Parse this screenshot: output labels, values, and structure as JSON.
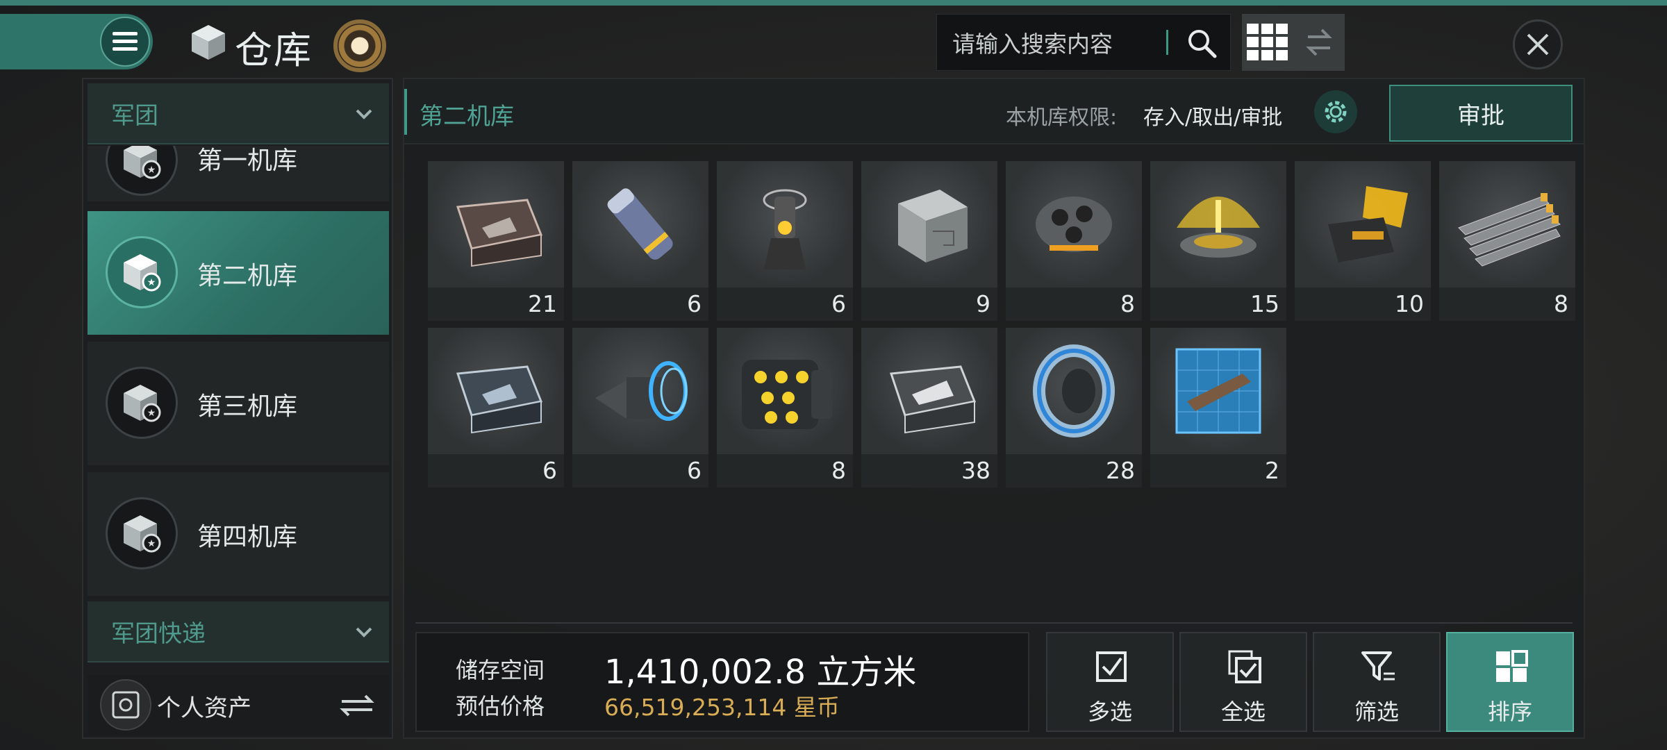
{
  "header": {
    "title": "仓库"
  },
  "search": {
    "placeholder": "请输入搜索内容"
  },
  "left_panel": {
    "group_label": "军团",
    "partial_item_label": "第一机库",
    "hangars": [
      {
        "label": "第二机库",
        "selected": true
      },
      {
        "label": "第三机库",
        "selected": false
      },
      {
        "label": "第四机库",
        "selected": false
      }
    ],
    "express_label": "军团快递",
    "personal_label": "个人资产"
  },
  "hangar": {
    "title": "第二机库",
    "permission_label": "本机库权限:",
    "permission_value": "存入/取出/审批",
    "approve_label": "审批"
  },
  "items": [
    {
      "icon": "ship-crate-icon",
      "count": "21"
    },
    {
      "icon": "canister-icon",
      "count": "6"
    },
    {
      "icon": "beacon-device-icon",
      "count": "6"
    },
    {
      "icon": "armor-plate-icon",
      "count": "9"
    },
    {
      "icon": "launcher-module-icon",
      "count": "8"
    },
    {
      "icon": "scanner-pad-icon",
      "count": "15"
    },
    {
      "icon": "shield-generator-icon",
      "count": "10"
    },
    {
      "icon": "metal-bars-icon",
      "count": "8"
    },
    {
      "icon": "ship-crate-blue-icon",
      "count": "6"
    },
    {
      "icon": "thruster-icon",
      "count": "6"
    },
    {
      "icon": "missile-pod-icon",
      "count": "8"
    },
    {
      "icon": "ship-crate-white-icon",
      "count": "38"
    },
    {
      "icon": "ring-module-icon",
      "count": "28"
    },
    {
      "icon": "ship-blueprint-icon",
      "count": "2"
    }
  ],
  "storage": {
    "space_label": "储存空间",
    "space_value": "1,410,002.8 立方米",
    "price_label": "预估价格",
    "price_value": "66,519,253,114 星币"
  },
  "actions": [
    {
      "label": "多选",
      "icon": "multi-select-icon"
    },
    {
      "label": "全选",
      "icon": "select-all-icon"
    },
    {
      "label": "筛选",
      "icon": "filter-icon"
    },
    {
      "label": "排序",
      "icon": "sort-icon",
      "active": true
    }
  ],
  "colors": {
    "accent": "#3f9a8a",
    "price": "#d9ad55",
    "panel": "#1c1e1f"
  }
}
